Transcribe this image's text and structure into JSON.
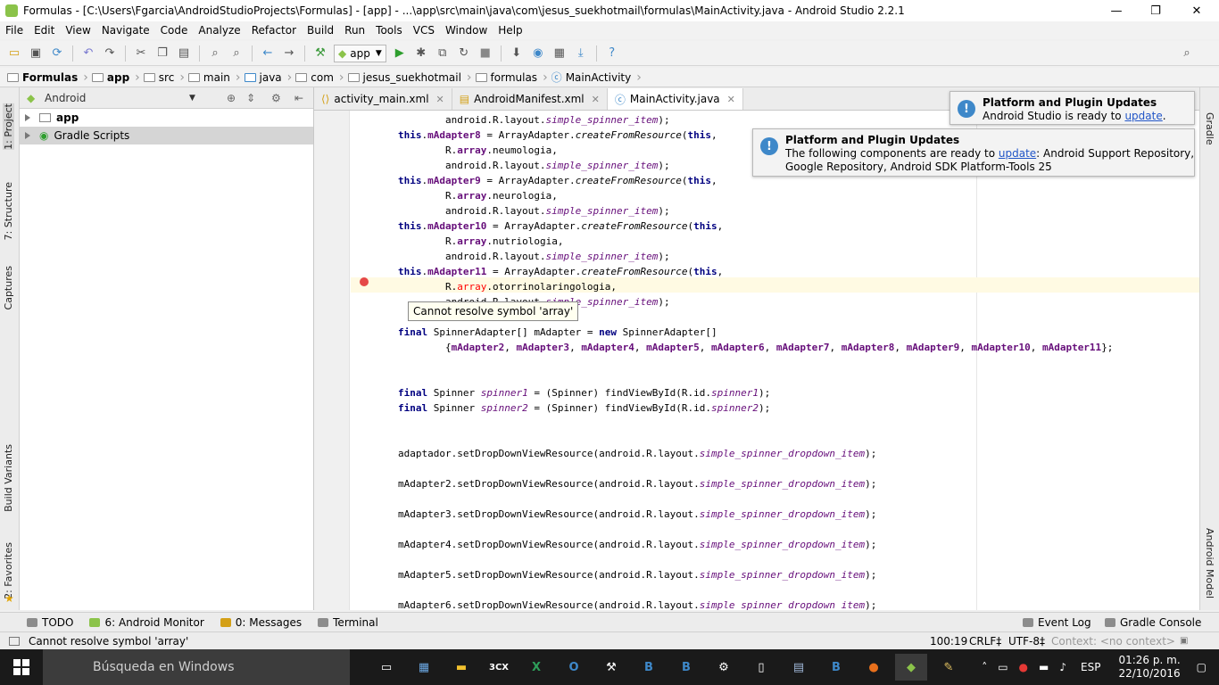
{
  "window": {
    "title": "Formulas - [C:\\Users\\Fgarcia\\AndroidStudioProjects\\Formulas] - [app] - ...\\app\\src\\main\\java\\com\\jesus_suekhotmail\\formulas\\MainActivity.java - Android Studio 2.2.1",
    "minimize": "—",
    "restore": "❐",
    "close": "✕"
  },
  "menu": [
    "File",
    "Edit",
    "View",
    "Navigate",
    "Code",
    "Analyze",
    "Refactor",
    "Build",
    "Run",
    "Tools",
    "VCS",
    "Window",
    "Help"
  ],
  "toolbar": {
    "run_config": "app",
    "icons": [
      "open-icon",
      "save-icon",
      "sync-icon",
      "undo-icon",
      "redo-icon",
      "cut-icon",
      "copy-icon",
      "paste-icon",
      "find-icon",
      "replace-icon",
      "back-icon",
      "forward-icon",
      "make-icon",
      "run-icon",
      "debug-icon",
      "attach-icon",
      "apply-changes-icon",
      "stop-icon",
      "sdk-manager-icon",
      "avd-manager-icon",
      "project-structure-icon",
      "gradle-sync-icon",
      "help-icon",
      "search-everywhere-icon"
    ]
  },
  "breadcrumbs": [
    "Formulas",
    "app",
    "src",
    "main",
    "java",
    "com",
    "jesus_suekhotmail",
    "formulas",
    "MainActivity"
  ],
  "left_strip": {
    "project": "1: Project",
    "structure": "7: Structure",
    "captures": "Captures",
    "build_variants": "Build Variants",
    "favorites": "2: Favorites"
  },
  "right_strip": {
    "gradle": "Gradle",
    "android_model": "Android Model"
  },
  "project_panel": {
    "view": "Android",
    "items": [
      {
        "label": "app"
      },
      {
        "label": "Gradle Scripts"
      }
    ]
  },
  "tabs": [
    {
      "label": "activity_main.xml"
    },
    {
      "label": "AndroidManifest.xml"
    },
    {
      "label": "MainActivity.java"
    }
  ],
  "code_lines": [
    "                android.R.layout.simple_spinner_item);",
    "        this.mAdapter8 = ArrayAdapter.createFromResource(this,",
    "                R.array.neumologia,",
    "                android.R.layout.simple_spinner_item);",
    "        this.mAdapter9 = ArrayAdapter.createFromResource(this,",
    "                R.array.neurologia,",
    "                android.R.layout.simple_spinner_item);",
    "        this.mAdapter10 = ArrayAdapter.createFromResource(this,",
    "                R.array.nutriologia,",
    "                android.R.layout.simple_spinner_item);",
    "        this.mAdapter11 = ArrayAdapter.createFromResource(this,",
    "                R.array.otorrinolaringologia,",
    "                android.R.layout.simple_spinner_item);",
    "",
    "        final SpinnerAdapter[] mAdapter = new SpinnerAdapter[]",
    "                {mAdapter2, mAdapter3, mAdapter4, mAdapter5, mAdapter6, mAdapter7, mAdapter8, mAdapter9, mAdapter10, mAdapter11};",
    "",
    "",
    "        final Spinner spinner1 = (Spinner) findViewById(R.id.spinner1);",
    "        final Spinner spinner2 = (Spinner) findViewById(R.id.spinner2);",
    "",
    "",
    "        adaptador.setDropDownViewResource(android.R.layout.simple_spinner_dropdown_item);",
    "",
    "        mAdapter2.setDropDownViewResource(android.R.layout.simple_spinner_dropdown_item);",
    "",
    "        mAdapter3.setDropDownViewResource(android.R.layout.simple_spinner_dropdown_item);",
    "",
    "        mAdapter4.setDropDownViewResource(android.R.layout.simple_spinner_dropdown_item);",
    "",
    "        mAdapter5.setDropDownViewResource(android.R.layout.simple_spinner_dropdown_item);",
    "",
    "        mAdapter6.setDropDownViewResource(android.R.layout.simple_spinner_dropdown_item);"
  ],
  "tooltip": "Cannot resolve symbol 'array'",
  "notifications": [
    {
      "title": "Platform and Plugin Updates",
      "body_prefix": "Android Studio is ready to ",
      "link": "update",
      "body_suffix": "."
    },
    {
      "title": "Platform and Plugin Updates",
      "body_prefix": "The following components are ready to ",
      "link": "update",
      "body_suffix": ": Android Support Repository,",
      "body_line2": "Google Repository, Android SDK Platform-Tools 25"
    }
  ],
  "tool_windows": {
    "todo": "TODO",
    "android_monitor": "6: Android Monitor",
    "messages": "0: Messages",
    "terminal": "Terminal",
    "event_log": "Event Log",
    "gradle_console": "Gradle Console"
  },
  "status": {
    "message": "Cannot resolve symbol 'array'",
    "position": "100:19",
    "line_sep": "CRLF‡",
    "encoding": "UTF-8‡",
    "context": "Context: <no context>"
  },
  "taskbar": {
    "search_placeholder": "Búsqueda en Windows",
    "apps": [
      "task-view-icon",
      "network-app-icon",
      "file-explorer-icon",
      "3cx-icon",
      "excel-icon",
      "outlook-icon",
      "tools-icon",
      "b-app-icon",
      "b-app-icon",
      "settings-icon",
      "notepad-icon",
      "document-icon",
      "b-app-icon",
      "firefox-icon",
      "android-studio-icon",
      "paint-icon"
    ],
    "app_3cx": "3CX",
    "language": "ESP",
    "time": "01:26 p. m.",
    "date": "22/10/2016"
  },
  "colors": {
    "keyword": "#000080",
    "field": "#660e7a",
    "error": "#ff0000",
    "caret_line": "#fffae3",
    "link": "#2155c7",
    "taskbar": "#1a1a1a"
  }
}
